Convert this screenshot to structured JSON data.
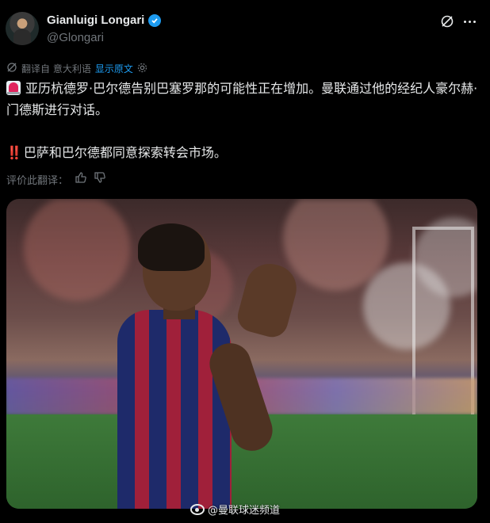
{
  "author": {
    "display_name": "Gianluigi Longari",
    "handle": "@Glongari",
    "verified": true
  },
  "translation_bar": {
    "label": "翻译自 意大利语",
    "show_original": "显示原文"
  },
  "tweet": {
    "line1": "亚历杭德罗·巴尔德告别巴塞罗那的可能性正在增加。曼联通过他的经纪人豪尔赫·门德斯进行对话。",
    "bang_emoji": "‼️",
    "line2": "巴萨和巴尔德都同意探索转会市场。"
  },
  "rate_translation": {
    "label": "评价此翻译："
  },
  "media": {
    "watermark": "@曼联球迷频道"
  },
  "icons": {
    "verified": "verified-badge-icon",
    "grok": "grok-icon",
    "more": "more-icon",
    "translate": "translate-icon",
    "settings": "gear-icon",
    "thumbs_up": "thumbs-up-icon",
    "thumbs_down": "thumbs-down-icon",
    "siren": "police-light-emoji",
    "weibo": "weibo-icon"
  },
  "colors": {
    "background": "#000000",
    "text": "#e7e9ea",
    "muted": "#71767b",
    "accent": "#1d9bf0"
  }
}
